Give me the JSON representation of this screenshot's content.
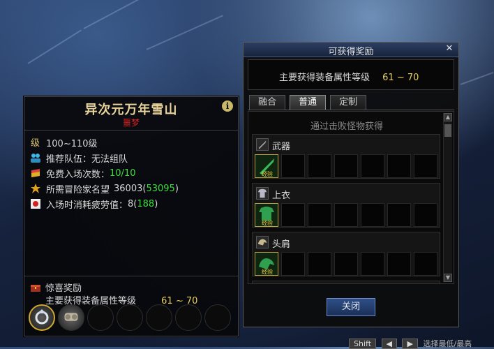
{
  "dungeon": {
    "name": "异次元万年雪山",
    "difficulty": "噩梦",
    "info_icon": "i",
    "rows": [
      {
        "icon": "level-icon",
        "label": "",
        "value": "100~110级"
      },
      {
        "icon": "party-icon",
        "label": "推荐队伍：",
        "value": "无法组队"
      },
      {
        "icon": "ticket-icon",
        "label": "免费入场次数：",
        "value": "10/10"
      },
      {
        "icon": "reputation-icon",
        "label": "所需冒险家名望",
        "value": "36003",
        "value_extra": "53095"
      },
      {
        "icon": "fatigue-icon",
        "label": "入场时消耗疲劳值：",
        "value": "8",
        "value_extra": "188"
      }
    ],
    "surprise_title": "惊喜奖励",
    "surprise_desc": "主要获得装备属性等级",
    "surprise_range": "61 ~ 70"
  },
  "reward_window": {
    "title": "可获得奖励",
    "close_glyph": "✕",
    "summary_label": "主要获得装备属性等级",
    "summary_range": "61 ~ 70",
    "tabs": [
      "融合",
      "普通",
      "定制"
    ],
    "active_tab": 1,
    "hint": "通过击败怪物获得",
    "categories": [
      {
        "label": "武器",
        "badge": "经验"
      },
      {
        "label": "上衣",
        "badge": "经验"
      },
      {
        "label": "头肩",
        "badge": "经验"
      }
    ],
    "close_button": "关闭"
  },
  "bottom_bar": {
    "buttons": [
      "Shift",
      "◀",
      "▶"
    ],
    "text": "选择最低/最高"
  }
}
